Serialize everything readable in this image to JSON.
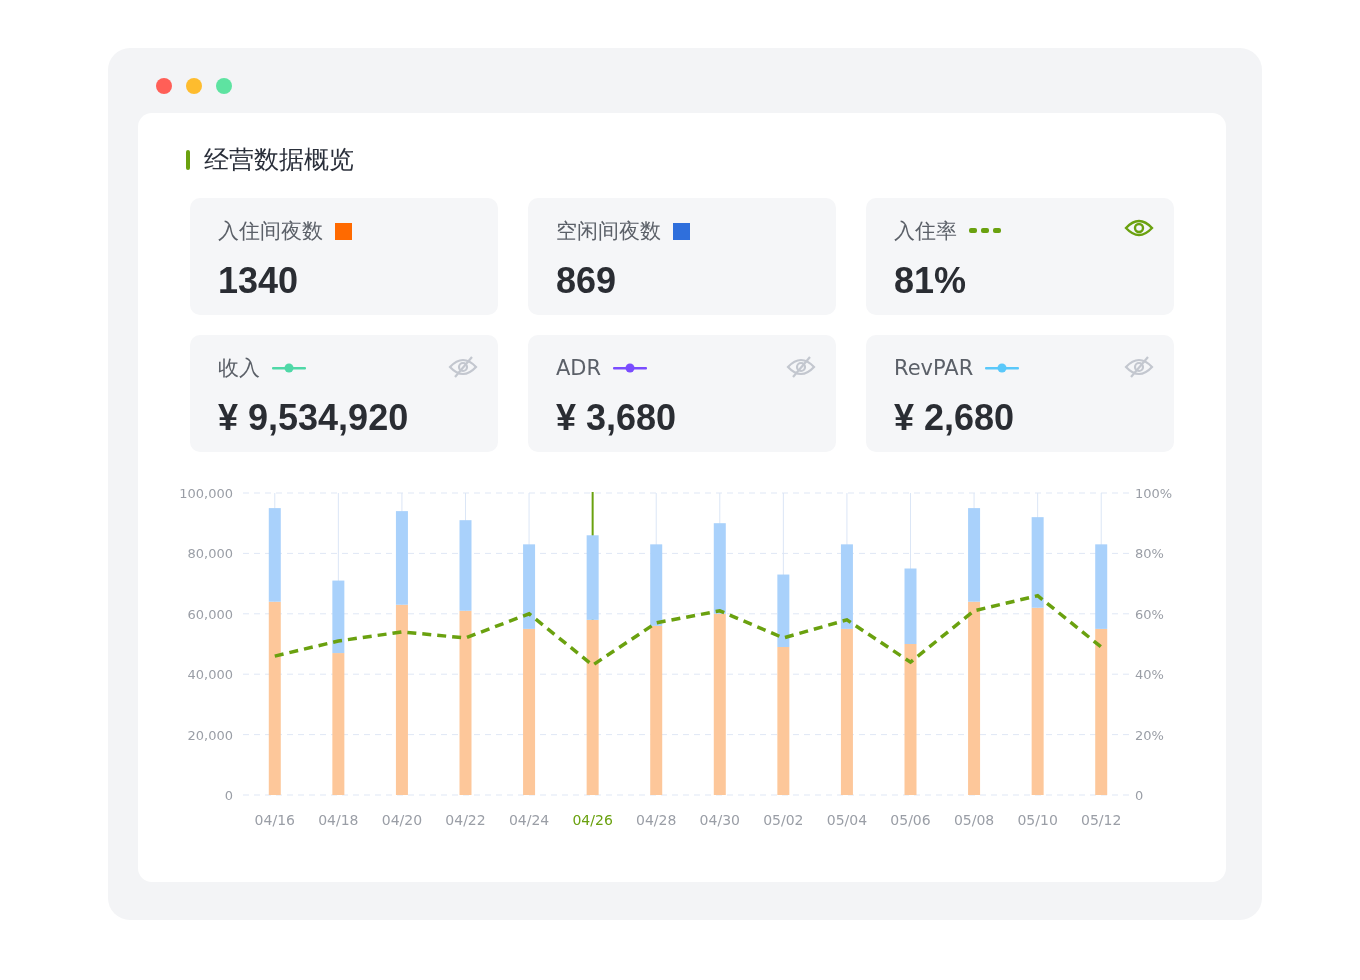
{
  "title": "经营数据概览",
  "cards": [
    {
      "label": "入住间夜数",
      "kind": "square",
      "color": "#ff6a00",
      "value": "1340"
    },
    {
      "label": "空闲间夜数",
      "kind": "square",
      "color": "#2f6fdc",
      "value": "869"
    },
    {
      "label": "入住率",
      "kind": "dashes",
      "color": "#6aa10f",
      "value": "81%",
      "eye": {
        "visible": true
      }
    },
    {
      "label": "收入",
      "kind": "dotline",
      "color": "#4fd8a7",
      "value": "¥ 9,534,920",
      "eye": {
        "visible": false
      }
    },
    {
      "label": "ADR",
      "kind": "dotline",
      "color": "#7a4cff",
      "value": "¥ 3,680",
      "eye": {
        "visible": false
      }
    },
    {
      "label": "RevPAR",
      "kind": "dotline",
      "color": "#5ac8fa",
      "value": "¥ 2,680",
      "eye": {
        "visible": false
      }
    }
  ],
  "chart_data": {
    "type": "bar",
    "stacked": true,
    "categories": [
      "04/16",
      "04/18",
      "04/20",
      "04/22",
      "04/24",
      "04/26",
      "04/28",
      "04/30",
      "05/02",
      "05/04",
      "05/06",
      "05/08",
      "05/10",
      "05/12"
    ],
    "series": [
      {
        "color": "#fdc79a",
        "values": [
          64000,
          47000,
          63000,
          61000,
          55000,
          58000,
          56000,
          60000,
          49000,
          55000,
          50000,
          64000,
          62000,
          55000
        ]
      },
      {
        "color": "#a9d1fb",
        "values": [
          31000,
          24000,
          31000,
          30000,
          28000,
          28000,
          27000,
          30000,
          24000,
          28000,
          25000,
          31000,
          30000,
          28000
        ]
      },
      {
        "color": "#6aa10f",
        "type": "line",
        "line_style": "dashed",
        "axis": "y2",
        "values": [
          0.46,
          0.51,
          0.54,
          0.52,
          0.6,
          0.43,
          0.57,
          0.61,
          0.52,
          0.58,
          0.44,
          0.61,
          0.66,
          0.49
        ]
      }
    ],
    "grid": true,
    "ylim": [
      0,
      100000
    ],
    "yticks": [
      {
        "value": 0,
        "label": "0"
      },
      {
        "value": 20000,
        "label": "20,000"
      },
      {
        "value": 40000,
        "label": "40,000"
      },
      {
        "value": 60000,
        "label": "60,000"
      },
      {
        "value": 80000,
        "label": "80,000"
      },
      {
        "value": 100000,
        "label": "100,000"
      }
    ],
    "y2lim": [
      0,
      1
    ],
    "y2ticks": [
      {
        "value": 0,
        "label": "0"
      },
      {
        "value": 0.2,
        "label": "20%"
      },
      {
        "value": 0.4,
        "label": "40%"
      },
      {
        "value": 0.6,
        "label": "60%"
      },
      {
        "value": 0.8,
        "label": "80%"
      },
      {
        "value": 1,
        "label": "100%"
      }
    ],
    "ref_lines": [
      {
        "axis": "x",
        "value": "04/26",
        "color": "#6aa10f"
      }
    ]
  }
}
